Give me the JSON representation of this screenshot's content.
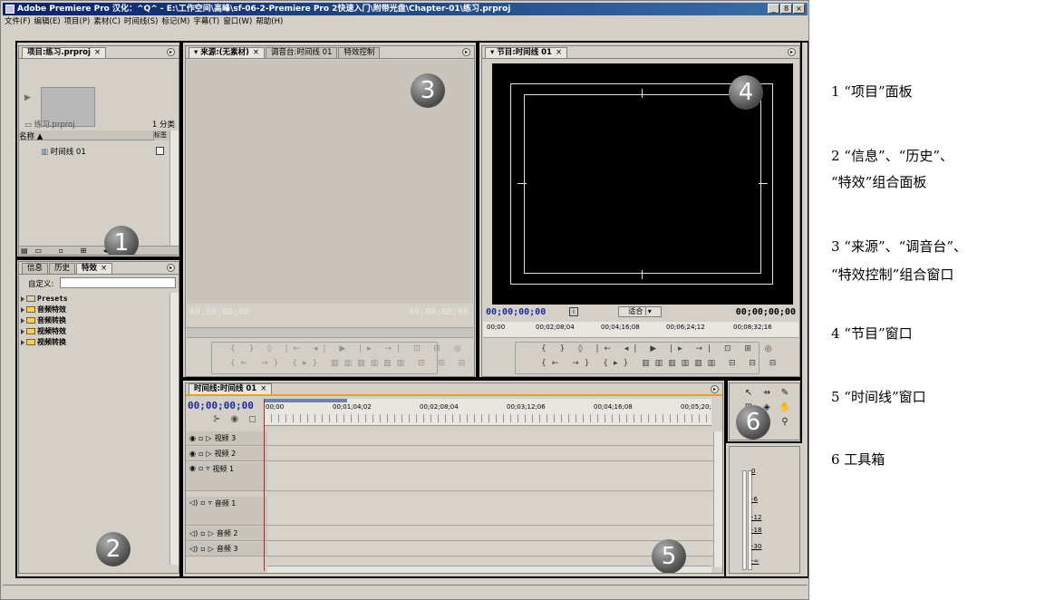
{
  "app": {
    "title": "Adobe Premiere Pro 汉化：^Q^ - E:\\工作空间\\高峰\\sf-06-2-Premiere Pro 2快速入门\\附带光盘\\Chapter-01\\练习.prproj",
    "window_buttons": [
      "_",
      "8",
      "×"
    ],
    "menu": [
      "文件(F)",
      "编辑(E)",
      "项目(P)",
      "素材(C)",
      "时间线(S)",
      "标记(M)",
      "字幕(T)",
      "窗口(W)",
      "帮助(H)"
    ]
  },
  "project_panel": {
    "tab": "项目:练习.prproj",
    "close": "×",
    "file_name": "练习.prproj",
    "count": "1 分类",
    "col_name": "名称",
    "col_label": "标签",
    "item": "时间线 01",
    "number": "1"
  },
  "effects_panel": {
    "tabs": [
      "信息",
      "历史",
      "特效"
    ],
    "custom_label": "自定义:",
    "custom_value": "",
    "items": [
      "Presets",
      "音频特效",
      "音频转换",
      "视频特效",
      "视频转换"
    ],
    "number": "2"
  },
  "source_panel": {
    "tabs": [
      "来源:(无素材)",
      "调音台:时间线 01",
      "特效控制"
    ],
    "timecode_left": "00;00;00;00",
    "timecode_right": "00;00;00;00",
    "number": "3"
  },
  "program_panel": {
    "tab": "节目:时间线 01",
    "timecode_left": "00;00;00;00",
    "fit": "适合",
    "timecode_right": "00;00;00;00",
    "ruler": [
      "00;00",
      "00;02;08;04",
      "00;04;16;08",
      "00;06;24;12",
      "00;08;32;16"
    ],
    "number": "4"
  },
  "timeline_panel": {
    "tab": "时间线:时间线 01",
    "timecode": "00;00;00;00",
    "ruler": [
      "00;00",
      "00;01;04;02",
      "00;02;08;04",
      "00;03;12;06",
      "00;04;16;08",
      "00;05;20;"
    ],
    "tracks": [
      "视频 3",
      "视频 2",
      "视频 1",
      "音频 1",
      "音频 2",
      "音频 3"
    ],
    "number": "5"
  },
  "tools_panel": {
    "number": "6",
    "meter_ticks": [
      "0",
      "-6",
      "-12",
      "-18",
      "-30",
      "-∞"
    ]
  },
  "captions": [
    "1 “项目”面板",
    "2 “信息”、“历史”、",
    "“特效”组合面板",
    "3 “来源”、“调音台”、",
    "“特效控制”组合窗口",
    "4 “节目”窗口",
    "5 “时间线”窗口",
    "6 工具箱"
  ]
}
